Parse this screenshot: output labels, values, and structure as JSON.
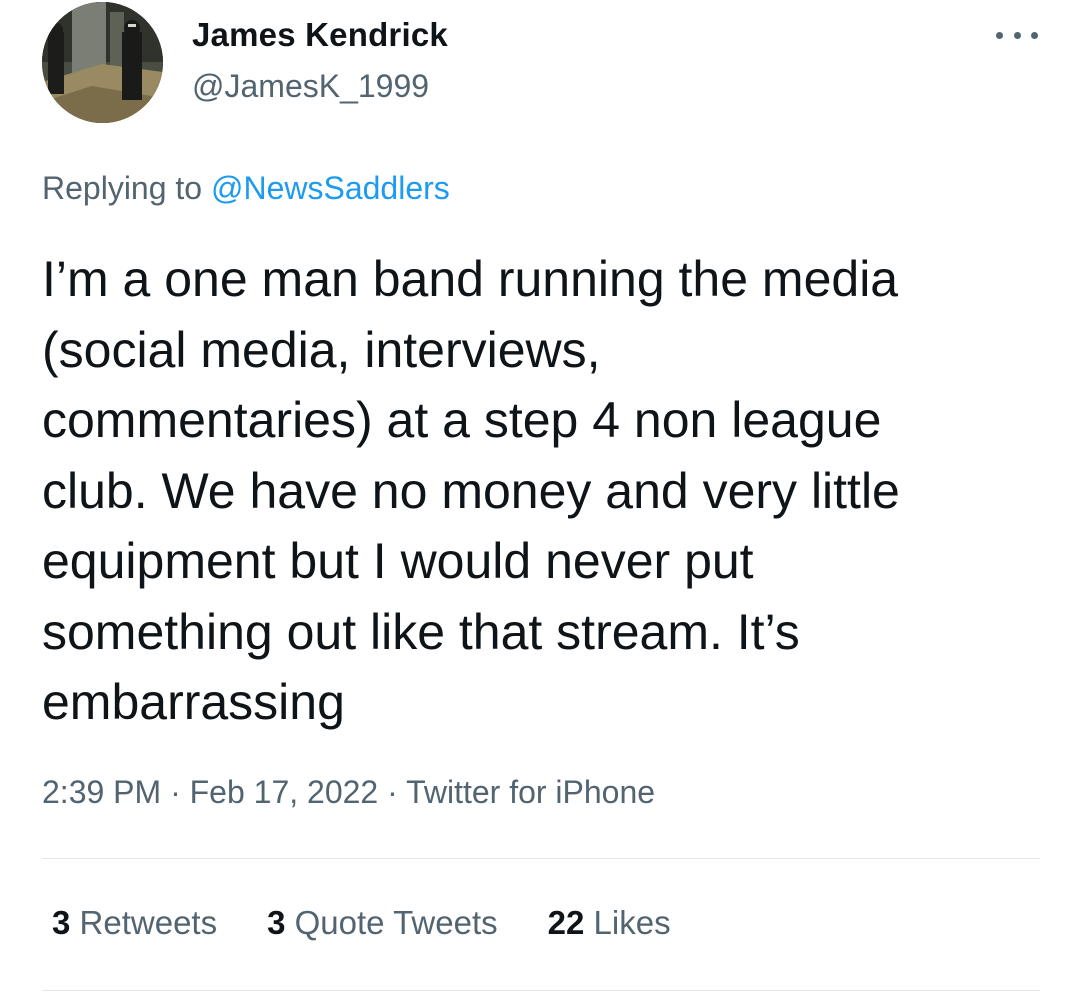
{
  "author": {
    "display_name": "James Kendrick",
    "handle": "@JamesK_1999"
  },
  "reply": {
    "prefix": "Replying to ",
    "mention": "@NewsSaddlers"
  },
  "tweet_text": "I’m a one man band running the media\n(social media, interviews,\ncommentaries) at a step 4 non league\nclub. We have no money and very little\nequipment but I would never put\nsomething out like that stream. It’s\nembarrassing",
  "meta": {
    "time": "2:39 PM",
    "separator": " · ",
    "date": "Feb 17, 2022",
    "source": "Twitter for iPhone"
  },
  "stats": {
    "retweets_count": "3",
    "retweets_label": " Retweets",
    "quotes_count": "3",
    "quotes_label": " Quote Tweets",
    "likes_count": "22",
    "likes_label": " Likes"
  },
  "icons": {
    "more": "more-horizontal-icon"
  },
  "colors": {
    "text": "#0f1419",
    "secondary": "#536471",
    "link": "#1d9bf0",
    "divider": "#e3e6e8"
  }
}
